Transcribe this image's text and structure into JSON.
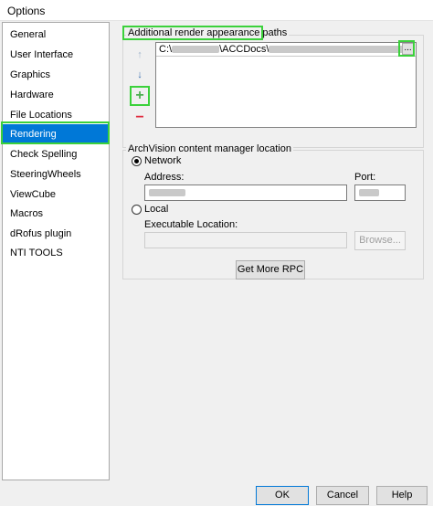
{
  "window": {
    "title": "Options"
  },
  "sidebar": {
    "items": [
      {
        "label": "General"
      },
      {
        "label": "User Interface"
      },
      {
        "label": "Graphics"
      },
      {
        "label": "Hardware"
      },
      {
        "label": "File Locations"
      },
      {
        "label": "Rendering",
        "selected": true
      },
      {
        "label": "Check Spelling"
      },
      {
        "label": "SteeringWheels"
      },
      {
        "label": "ViewCube"
      },
      {
        "label": "Macros"
      },
      {
        "label": "dRofus plugin"
      },
      {
        "label": "NTI TOOLS"
      }
    ]
  },
  "render_paths": {
    "legend": "Additional render appearance paths",
    "path_prefix": "C:\\",
    "path_visible": "\\ACCDocs\\",
    "browse_small": "..."
  },
  "archvision": {
    "legend": "ArchVision content manager location",
    "network_label": "Network",
    "address_label": "Address:",
    "port_label": "Port:",
    "local_label": "Local",
    "exe_label": "Executable Location:",
    "browse_label": "Browse...",
    "get_rpc_label": "Get More RPC",
    "selected_option": "Network"
  },
  "footer": {
    "ok_label": "OK",
    "cancel_label": "Cancel",
    "help_label": "Help"
  },
  "colors": {
    "highlight": "#3bd13b",
    "selection": "#0078d7",
    "add_icon": "#4caf50",
    "remove_icon": "#e0283c",
    "move_icon": "#3a6fb0"
  },
  "icons": {
    "move_up": "move-up-icon",
    "move_down": "move-down-icon",
    "add": "add-icon",
    "remove": "remove-icon"
  }
}
